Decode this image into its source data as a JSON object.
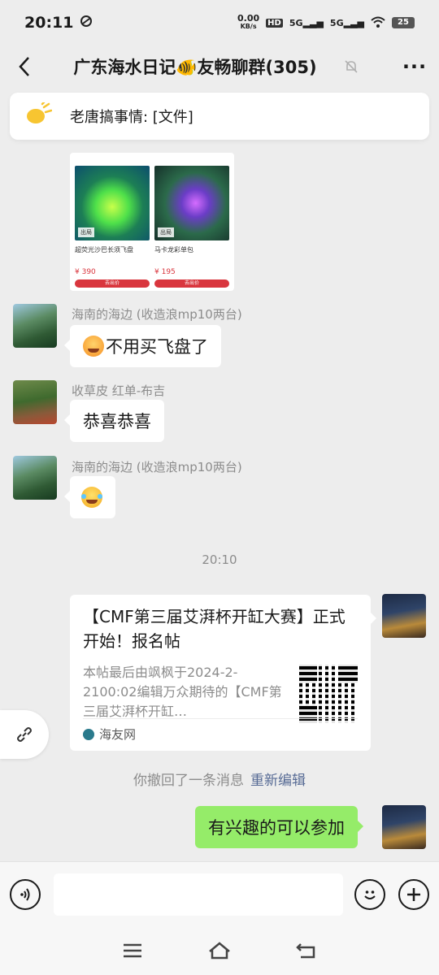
{
  "status_bar": {
    "time": "20:11",
    "speed_value": "0.00",
    "speed_unit": "KB/s",
    "hd_label": "HD",
    "sim1_label": "5G",
    "sim2_label": "5G",
    "battery": "25"
  },
  "header": {
    "title": "广东海水日记🐠友畅聊群(305)"
  },
  "pinned": {
    "text": "老唐搞事情: [文件]"
  },
  "product_card": {
    "items": [
      {
        "tag": "出局",
        "name": "超荧光沙巴长须飞盘",
        "price": "¥ 390",
        "button": "去出价"
      },
      {
        "tag": "出局",
        "name": "马卡龙彩单包",
        "price": "¥ 195",
        "button": "去出价"
      }
    ]
  },
  "messages": [
    {
      "sender": "海南的海边 (收造浪mp10两台)",
      "text": "不用买飞盘了"
    },
    {
      "sender": "收草皮 红单-布吉",
      "text": "恭喜恭喜"
    },
    {
      "sender": "海南的海边 (收造浪mp10两台)",
      "text": ""
    }
  ],
  "timestamp": "20:10",
  "link_card": {
    "title": "【CMF第三届艾湃杯开缸大赛】正式开始！报名帖",
    "description": "本帖最后由飒枫于2024-2-2100:02编辑万众期待的【CMF第三届艾湃杯开缸…",
    "source": "海友网"
  },
  "recall": {
    "text": "你撤回了一条消息",
    "edit": "重新编辑"
  },
  "my_message": "有兴趣的可以参加",
  "input": {
    "placeholder": ""
  },
  "colors": {
    "background": "#ededed",
    "my_bubble": "#95ec69",
    "link": "#576b95",
    "price": "#d9363e"
  }
}
